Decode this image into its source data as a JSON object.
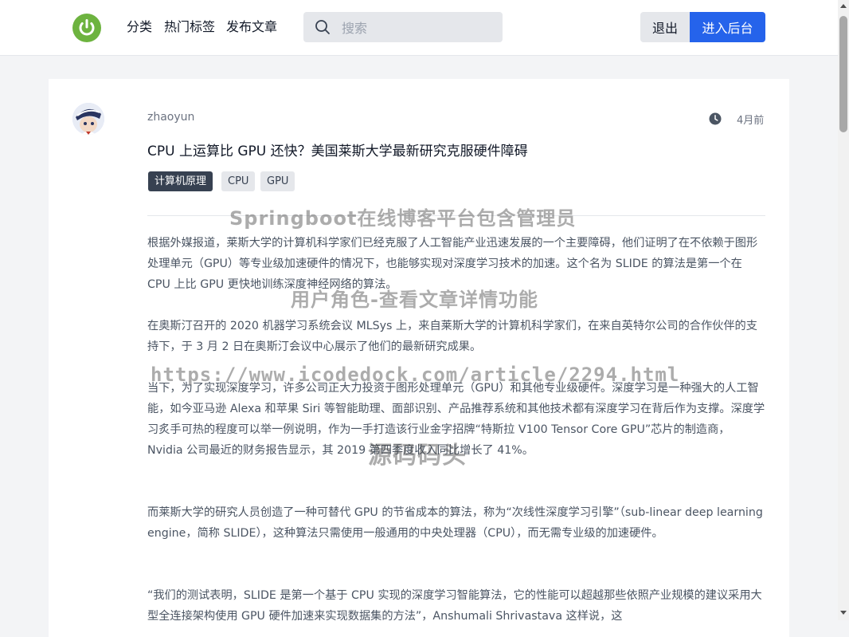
{
  "header": {
    "nav": [
      "分类",
      "热门标签",
      "发布文章"
    ],
    "search_placeholder": "搜索",
    "logout_label": "退出",
    "admin_label": "进入后台",
    "logo_icon": "power-icon",
    "brand_color": "#6db33f",
    "accent_color": "#2563eb"
  },
  "article": {
    "author": "zhaoyun",
    "time_ago": "4月前",
    "title": "CPU 上运算比 GPU 还快？美国莱斯大学最新研究克服硬件障碍",
    "tags": [
      "计算机原理",
      "CPU",
      "GPU"
    ],
    "paragraphs": [
      "根据外媒报道，莱斯大学的计算机科学家们已经克服了人工智能产业迅速发展的一个主要障碍，他们证明了在不依赖于图形处理单元（GPU）等专业级加速硬件的情况下，也能够实现对深度学习技术的加速。这个名为 SLIDE 的算法是第一个在 CPU 上比 GPU 更快地训练深度神经网络的算法。",
      "在奥斯汀召开的 2020 机器学习系统会议 MLSys 上，来自莱斯大学的计算机科学家们，在来自英特尔公司的合作伙伴的支持下，于 3 月 2 日在奥斯汀会议中心展示了他们的最新研究成果。",
      "当下，为了实现深度学习，许多公司正大力投资于图形处理单元（GPU）和其他专业级硬件。深度学习是一种强大的人工智能，如今亚马逊 Alexa 和苹果 Siri 等智能助理、面部识别、产品推荐系统和其他技术都有深度学习在背后作为支撑。深度学习炙手可热的程度可以举一例说明，作为一手打造该行业金字招牌“特斯拉 V100 Tensor Core GPU”芯片的制造商，Nvidia 公司最近的财务报告显示，其 2019 第四季度收入同比增长了 41%。",
      "而莱斯大学的研究人员创造了一种可替代 GPU 的节省成本的算法，称为“次线性深度学习引擎”（sub-linear deep learning engine，简称 SLIDE），这种算法只需使用一般通用的中央处理器（CPU），而无需专业级的加速硬件。",
      "“我们的测试表明，SLIDE 是第一个基于 CPU 实现的深度学习智能算法，它的性能可以超越那些依照产业规模的建议采用大型全连接架构使用 GPU 硬件加速来实现数据集的方法”，Anshumali Shrivastava 这样说，这"
    ]
  },
  "watermarks": [
    "Springboot在线博客平台包含管理员",
    "用户角色-查看文章详情功能",
    "https://www.icodedock.com/article/2294.html",
    "源码码头"
  ]
}
